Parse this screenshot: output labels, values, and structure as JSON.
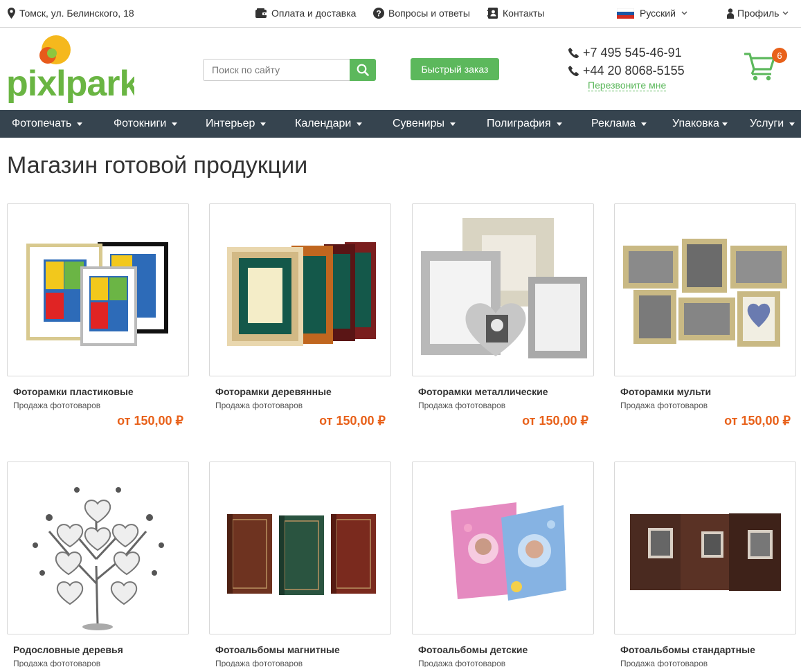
{
  "topbar": {
    "address": "Томск, ул. Белинского, 18",
    "payment": "Оплата и доставка",
    "faq": "Вопросы и ответы",
    "contacts": "Контакты",
    "language": "Русский",
    "profile": "Профиль"
  },
  "header": {
    "logo_text": "pixlpark",
    "search_placeholder": "Поиск по сайту",
    "quick_order": "Быстрый заказ",
    "phone1": "+7 495 545-46-91",
    "phone2": "+44 20 8068-5155",
    "callback": "Перезвоните мне",
    "cart_count": "6"
  },
  "nav": [
    {
      "label": "Фотопечать"
    },
    {
      "label": "Фотокниги"
    },
    {
      "label": "Интерьер"
    },
    {
      "label": "Календари"
    },
    {
      "label": "Сувениры"
    },
    {
      "label": "Полиграфия"
    },
    {
      "label": "Реклама"
    },
    {
      "label": "Упаковка"
    },
    {
      "label": "Услуги"
    }
  ],
  "page_title": "Магазин готовой продукции",
  "products": [
    {
      "name": "Фоторамки пластиковые",
      "category": "Продажа фототоваров",
      "price": "от 150,00 ₽"
    },
    {
      "name": "Фоторамки деревянные",
      "category": "Продажа фототоваров",
      "price": "от 150,00 ₽"
    },
    {
      "name": "Фоторамки металлические",
      "category": "Продажа фототоваров",
      "price": "от 150,00 ₽"
    },
    {
      "name": "Фоторамки мульти",
      "category": "Продажа фототоваров",
      "price": "от 150,00 ₽"
    },
    {
      "name": "Родословные деревья",
      "category": "Продажа фототоваров"
    },
    {
      "name": "Фотоальбомы магнитные",
      "category": "Продажа фототоваров"
    },
    {
      "name": "Фотоальбомы детские",
      "category": "Продажа фототоваров"
    },
    {
      "name": "Фотоальбомы стандартные",
      "category": "Продажа фототоваров"
    }
  ],
  "colors": {
    "accent_green": "#5cb85c",
    "nav_bg": "#36444f",
    "price_orange": "#e8611a"
  }
}
